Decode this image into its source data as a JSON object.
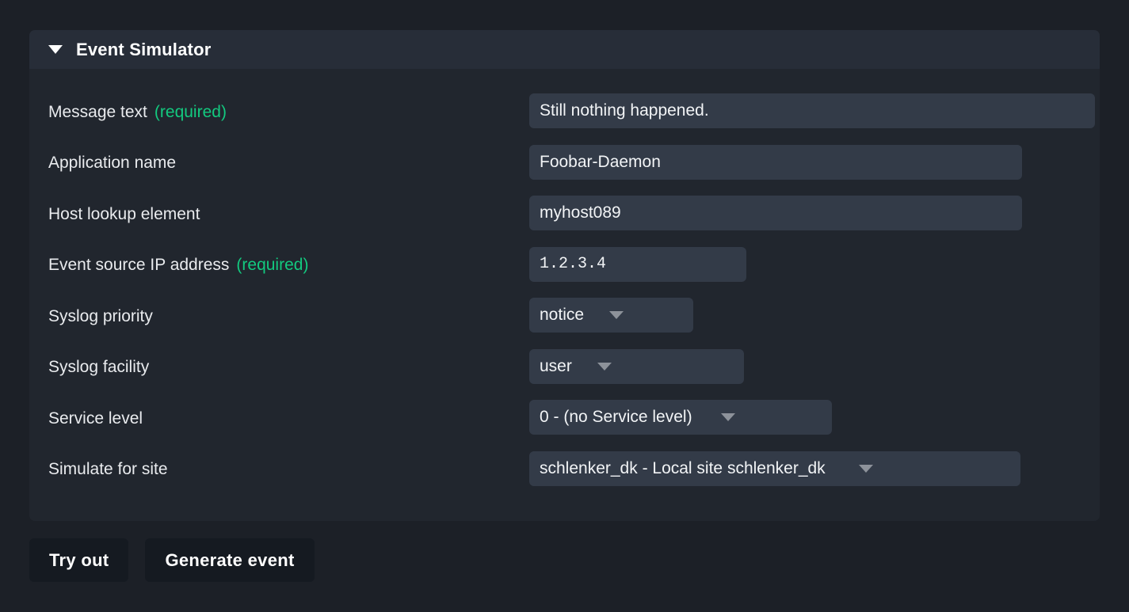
{
  "panel": {
    "title": "Event Simulator",
    "collapse_icon": "triangle-down-icon",
    "expanded": true
  },
  "form": {
    "required_marker": "(required)",
    "rows": [
      {
        "label": "Message text",
        "required": true,
        "control": "textbox",
        "value": "Still nothing happened."
      },
      {
        "label": "Application name",
        "required": false,
        "control": "textbox",
        "value": "Foobar-Daemon"
      },
      {
        "label": "Host lookup element",
        "required": false,
        "control": "textbox",
        "value": "myhost089"
      },
      {
        "label": "Event source IP address",
        "required": true,
        "control": "textbox",
        "value": "1.2.3.4"
      },
      {
        "label": "Syslog priority",
        "required": false,
        "control": "select",
        "value": "notice"
      },
      {
        "label": "Syslog facility",
        "required": false,
        "control": "select",
        "value": "user"
      },
      {
        "label": "Service level",
        "required": false,
        "control": "select",
        "value": "0 - (no Service level)"
      },
      {
        "label": "Simulate for site",
        "required": false,
        "control": "select",
        "value": "schlenker_dk - Local site schlenker_dk"
      }
    ]
  },
  "buttons": {
    "try_out": "Try out",
    "generate_event": "Generate event"
  },
  "colors": {
    "page_background": "#1c2027",
    "panel_background": "#21262e",
    "panel_header": "#272d38",
    "input_background": "#333b48",
    "button_background": "#151a21",
    "required_green": "#13c97f",
    "label_text": "#e9ebee",
    "leader_dots": "#6e7680",
    "caret_grey": "#8d929a"
  }
}
